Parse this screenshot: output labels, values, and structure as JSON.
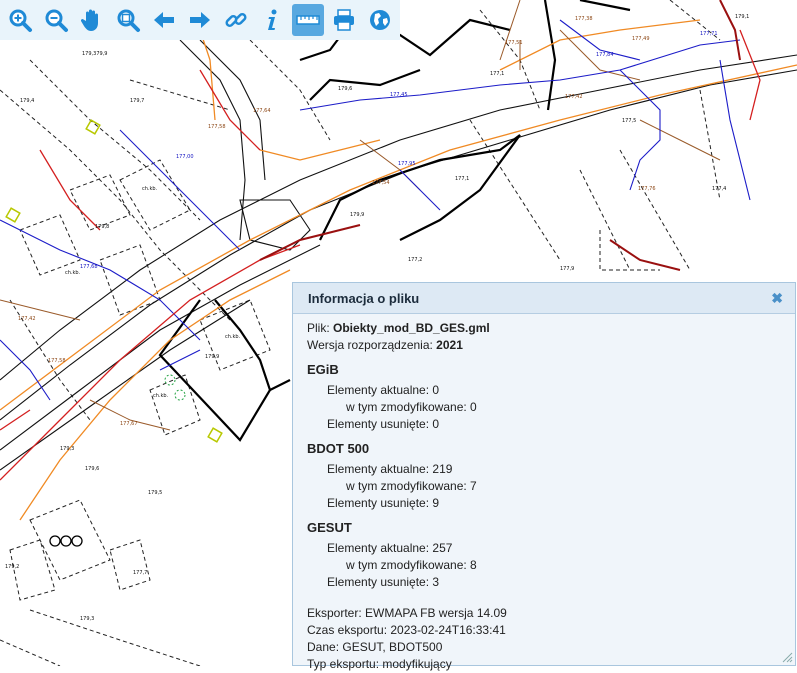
{
  "toolbar": {
    "buttons": [
      {
        "name": "zoom-in-button",
        "icon": "magnifier-plus-icon"
      },
      {
        "name": "zoom-out-button",
        "icon": "magnifier-minus-icon"
      },
      {
        "name": "pan-button",
        "icon": "hand-icon"
      },
      {
        "name": "zoom-extent-button",
        "icon": "magnifier-extent-icon"
      },
      {
        "name": "back-button",
        "icon": "arrow-left-icon"
      },
      {
        "name": "forward-button",
        "icon": "arrow-right-icon"
      },
      {
        "name": "link-button",
        "icon": "link-icon"
      },
      {
        "name": "info-button",
        "icon": "info-icon"
      },
      {
        "name": "measure-button",
        "icon": "ruler-icon",
        "active": true
      },
      {
        "name": "print-button",
        "icon": "printer-icon"
      },
      {
        "name": "globe-button",
        "icon": "globe-icon"
      }
    ],
    "accent": "#1f8ad6",
    "active_bg": "#58a8e0"
  },
  "map_labels": {
    "h1": "179,4",
    "h2": "179,7",
    "h3": "179,6",
    "h4": "179,8",
    "h5": "179,5",
    "h6": "177,7",
    "h7": "177,1",
    "h8": "177,2",
    "h9": "177,9",
    "h10": "177,5",
    "h11": "177,4",
    "h12": "179,1",
    "h13": "179,9",
    "h14": "179,2",
    "h15": "179,3",
    "h16": "179,379,9",
    "w1": "177,00",
    "w2": "177,84",
    "w3": "177,71",
    "w4": "177,68",
    "w5": "177,95",
    "w6": "177,45",
    "o1": "177,49",
    "o2": "177,38",
    "o3": "177,51",
    "o4": "177,42",
    "o5": "177,76",
    "o6": "177,64",
    "o7": "177,58",
    "o8": "177,54",
    "o9": "177,67",
    "c1": "ch.kb.",
    "c2": "ch.kb.",
    "c3": "ch.kb.",
    "c4": "ch.kb."
  },
  "panel": {
    "title": "Informacja o pliku",
    "file_label": "Plik: ",
    "file_value": "Obiekty_mod_BD_GES.gml",
    "version_label": "Wersja rozporządzenia: ",
    "version_value": "2021",
    "sections": [
      {
        "name": "EGiB",
        "current": "Elementy aktualne: 0",
        "modified": "w tym zmodyfikowane: 0",
        "deleted": "Elementy usunięte: 0"
      },
      {
        "name": "BDOT 500",
        "current": "Elementy aktualne: 219",
        "modified": "w tym zmodyfikowane: 7",
        "deleted": "Elementy usunięte: 9"
      },
      {
        "name": "GESUT",
        "current": "Elementy aktualne: 257",
        "modified": "w tym zmodyfikowane: 8",
        "deleted": "Elementy usunięte: 3"
      }
    ],
    "exporter": "Eksporter: EWMAPA FB wersja 14.09",
    "export_time": "Czas eksportu: 2023-02-24T16:33:41",
    "data": "Dane: GESUT, BDOT500",
    "export_type": "Typ eksportu: modyfikujący"
  }
}
